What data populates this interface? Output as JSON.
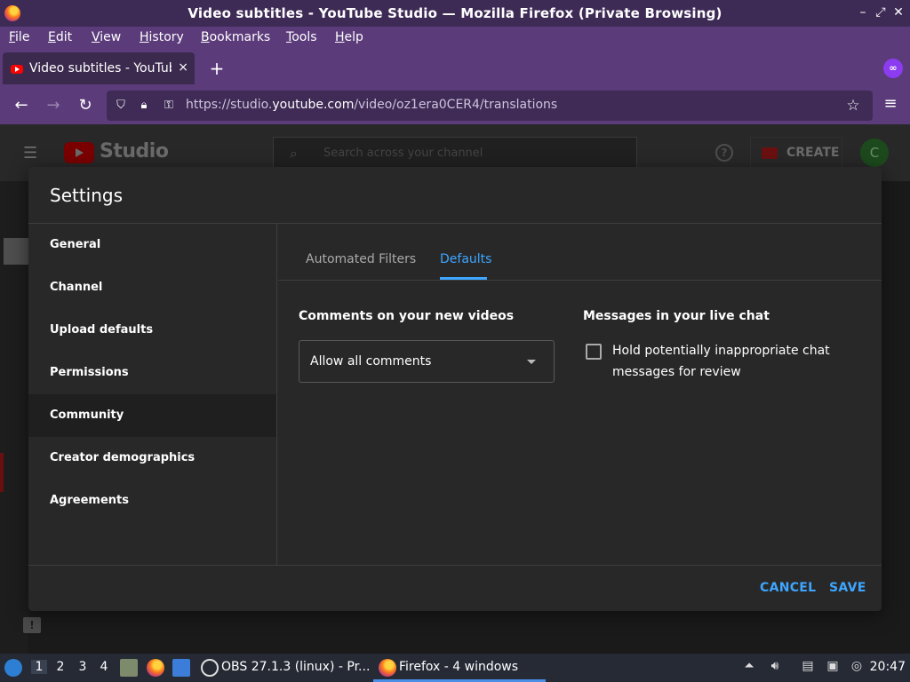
{
  "window": {
    "title": "Video subtitles - YouTube Studio — Mozilla Firefox (Private Browsing)"
  },
  "menu": {
    "items": [
      "File",
      "Edit",
      "View",
      "History",
      "Bookmarks",
      "Tools",
      "Help"
    ]
  },
  "tab": {
    "label": "Video subtitles - YouTube Studio",
    "close": "×",
    "new_tab": "+"
  },
  "nav": {
    "url_prefix": "https://studio.",
    "url_domain": "youtube.com",
    "url_path": "/video/oz1era0CER4/translations"
  },
  "studio": {
    "logo_text": "Studio",
    "search_placeholder": "Search across your channel",
    "create_label": "CREATE",
    "avatar_letter": "C",
    "help_glyph": "?"
  },
  "dialog": {
    "title": "Settings",
    "nav_items": [
      {
        "label": "General"
      },
      {
        "label": "Channel"
      },
      {
        "label": "Upload defaults"
      },
      {
        "label": "Permissions"
      },
      {
        "label": "Community",
        "active": true
      },
      {
        "label": "Creator demographics"
      },
      {
        "label": "Agreements"
      }
    ],
    "tabs": [
      {
        "label": "Automated Filters"
      },
      {
        "label": "Defaults",
        "active": true
      }
    ],
    "comments_title": "Comments on your new videos",
    "comments_value": "Allow all comments",
    "live_chat_title": "Messages in your live chat",
    "live_chat_checkbox_label": "Hold potentially inappropriate chat messages for review",
    "live_chat_checked": false,
    "cancel": "CANCEL",
    "save": "SAVE"
  },
  "taskbar": {
    "workspaces": [
      "1",
      "2",
      "3",
      "4"
    ],
    "active_workspace": "1",
    "tasks": [
      "OBS 27.1.3 (linux) - Pr...",
      "Firefox - 4 windows"
    ],
    "clock": "20:47"
  },
  "colors": {
    "accent": "#3ea6ff",
    "firefox_private_bar": "#5b3b7a"
  }
}
